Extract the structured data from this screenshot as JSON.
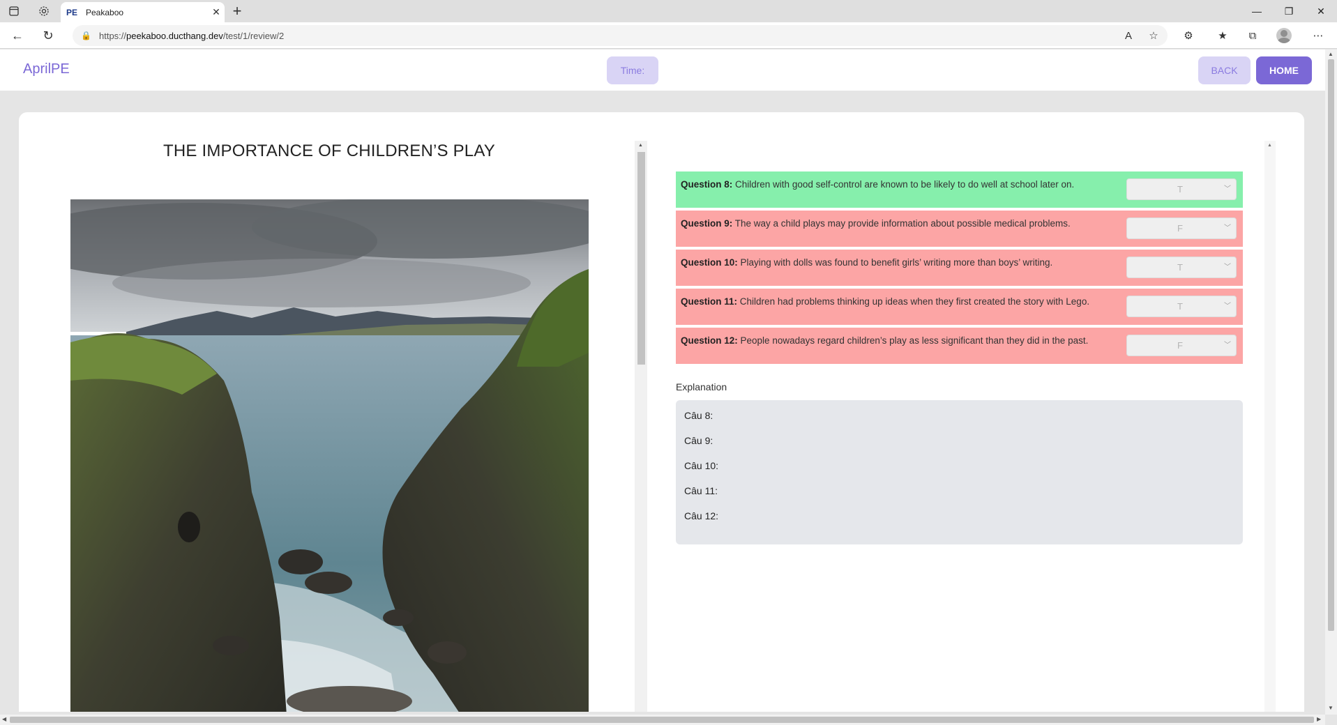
{
  "browser": {
    "tab_favicon": "PE",
    "tab_title": "Peakaboo",
    "url_prefix": "https://",
    "url_host": "peekaboo.ducthang.dev",
    "url_path": "/test/1/review/2",
    "icons": {
      "sidebar": "sidebar-toggle-icon",
      "settings": "gear-icon",
      "close_tab": "close-icon",
      "new_tab": "plus-icon",
      "minimize": "minimize-icon",
      "restore": "restore-icon",
      "close_window": "close-icon",
      "back": "arrow-left-icon",
      "refresh": "refresh-icon",
      "lock": "lock-icon",
      "read_aloud": "read-aloud-icon",
      "favorite_add": "star-plus-icon",
      "extensions": "puzzle-icon",
      "favorites": "favorites-icon",
      "collections": "collections-icon",
      "profile": "avatar",
      "more": "more-icon"
    }
  },
  "header": {
    "logo": "AprilPE",
    "time_label": "Time:",
    "back_label": "BACK",
    "home_label": "HOME"
  },
  "passage": {
    "title": "THE IMPORTANCE OF CHILDREN’S PLAY"
  },
  "questions": [
    {
      "label": "Question 8:",
      "text": "Children with good self-control are known to be likely to do well at school later on.",
      "answer": "T",
      "status": "correct"
    },
    {
      "label": "Question 9:",
      "text": "The way a child plays may provide information about possible medical problems.",
      "answer": "F",
      "status": "wrong"
    },
    {
      "label": "Question 10:",
      "text": "Playing with dolls was found to benefit girls’ writing more than boys’ writing.",
      "answer": "T",
      "status": "wrong"
    },
    {
      "label": "Question 11:",
      "text": "Children had problems thinking up ideas when they first created the story with Lego.",
      "answer": "T",
      "status": "wrong"
    },
    {
      "label": "Question 12:",
      "text": "People nowadays regard children’s play as less significant than they did in the past.",
      "answer": "F",
      "status": "wrong"
    }
  ],
  "explanation": {
    "label": "Explanation",
    "lines": [
      "Câu 8:",
      "Câu 9:",
      "Câu 10:",
      "Câu 11:",
      "Câu 12:"
    ]
  },
  "colors": {
    "brand": "#7b68d6",
    "brand_light": "#d9d4f5",
    "correct": "#86efac",
    "wrong": "#fca5a5",
    "explanation_bg": "#e5e7eb"
  }
}
